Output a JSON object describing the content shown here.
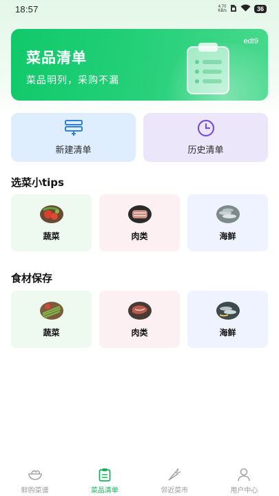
{
  "status_bar": {
    "time": "18:57",
    "net_speed_value": "4.70",
    "net_speed_unit": "KB/s",
    "battery": "36"
  },
  "banner": {
    "title": "菜品清单",
    "subtitle": "菜品明列，采购不漏",
    "code": "edt9"
  },
  "actions": {
    "new_list": "新建清单",
    "history_list": "历史清单"
  },
  "tips_section": {
    "title": "选菜小tips",
    "items": [
      "蔬菜",
      "肉类",
      "海鲜"
    ]
  },
  "storage_section": {
    "title": "食材保存",
    "items": [
      "蔬菜",
      "肉类",
      "海鲜"
    ]
  },
  "nav": {
    "items": [
      "鲜购菜谱",
      "菜品清单",
      "邻近菜市",
      "用户中心"
    ],
    "active_index": 1
  },
  "colors": {
    "brand_green": "#18b45c",
    "action_blue": "#2f7fd6",
    "action_purple": "#7a4fd3"
  },
  "icons": {
    "nav": [
      "bowl-icon",
      "clipboard-icon",
      "carrot-icon",
      "user-icon"
    ],
    "actions": [
      "new-list-icon",
      "clock-icon"
    ]
  }
}
